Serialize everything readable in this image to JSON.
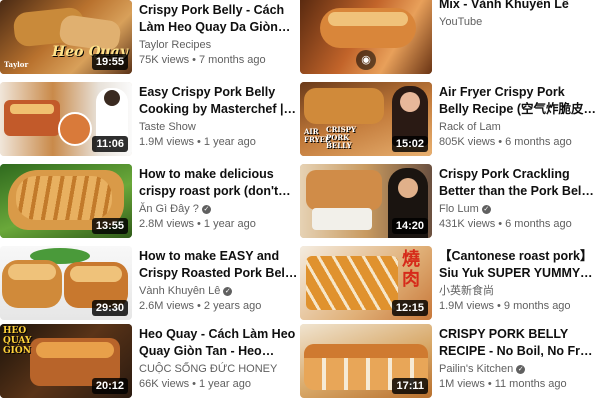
{
  "left": [
    {
      "title": "Crispy Pork Belly - Cách Làm Heo Quay Da Giòn Rụm, Ngày...",
      "channel": "Taylor Recipes",
      "verified": false,
      "views": "75K views",
      "age": "7 months ago",
      "duration": "19:55",
      "thumb_text": "Heo Quay",
      "thumb_small": "Taylor"
    },
    {
      "title": "Easy Crispy Pork Belly Cooking by Masterchef | 脆皮燒肉 •...",
      "channel": "Taste Show",
      "verified": false,
      "views": "1.9M views",
      "age": "1 year ago",
      "duration": "11:06"
    },
    {
      "title": "How to make delicious crispy roast pork (don't use rotary...",
      "channel": "Ăn Gì Đây ?",
      "verified": true,
      "views": "2.8M views",
      "age": "1 year ago",
      "duration": "13:55"
    },
    {
      "title": "How to make EASY and Crispy Roasted Pork Belly Super...",
      "channel": "Vành Khuyên Lê",
      "verified": true,
      "views": "2.6M views",
      "age": "2 years ago",
      "duration": "29:30"
    },
    {
      "title": "Heo Quay - Cách Làm Heo Quay Giòn Tan - Heo Quay...",
      "channel": "CUỘC SỐNG ĐỨC HONEY",
      "verified": false,
      "views": "66K views",
      "age": "1 year ago",
      "duration": "20:12",
      "thumb_text": "HEO QUAY GIÒN"
    }
  ],
  "right": [
    {
      "title_tail": "Mix - Vành Khuyên Lê",
      "channel": "YouTube",
      "mix_icon": "live-radio-icon"
    },
    {
      "title": "Air Fryer Crispy Pork Belly Recipe (空气炸脆皮烧肉) |...",
      "channel": "Rack of Lam",
      "verified": false,
      "views": "805K views",
      "age": "6 months ago",
      "duration": "15:02",
      "thumb_text": "AIR FRYER",
      "thumb_text2": "CRISPY PORK BELLY"
    },
    {
      "title": "Crispy Pork Crackling Better than the Pork Belly - Air Fryer...",
      "channel": "Flo Lum",
      "verified": true,
      "views": "431K views",
      "age": "6 months ago",
      "duration": "14:20"
    },
    {
      "title": "【Cantonese roast pork】Siu Yuk SUPER YUMMY and...",
      "channel": "小英新食尚",
      "verified": false,
      "views": "1.9M views",
      "age": "9 months ago",
      "duration": "12:15",
      "thumb_text": "燒肉"
    },
    {
      "title": "CRISPY PORK BELLY RECIPE - No Boil, No Fry, No Salt Crust...",
      "channel": "Pailin's Kitchen",
      "verified": true,
      "views": "1M views",
      "age": "11 months ago",
      "duration": "17:11"
    }
  ]
}
